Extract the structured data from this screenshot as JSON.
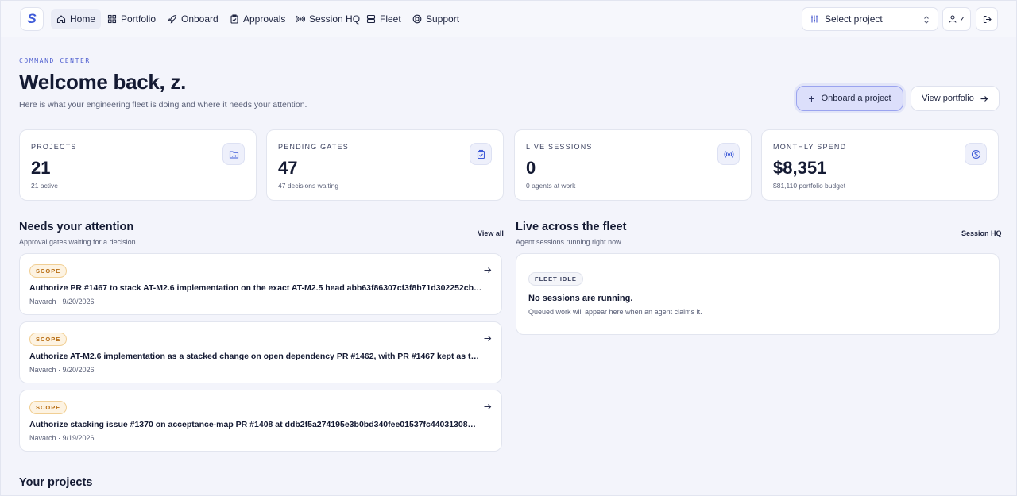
{
  "nav": {
    "logo_letter": "S",
    "items": [
      {
        "label": "Home",
        "icon": "home-icon"
      },
      {
        "label": "Portfolio",
        "icon": "grid-icon"
      },
      {
        "label": "Onboard",
        "icon": "rocket-icon"
      },
      {
        "label": "Approvals",
        "icon": "clipboard-check-icon"
      },
      {
        "label": "Session HQ",
        "icon": "broadcast-icon"
      },
      {
        "label": "Fleet",
        "icon": "server-icon"
      },
      {
        "label": "Support",
        "icon": "lifebuoy-icon"
      }
    ],
    "select_project": "Select project",
    "user_initial": "z"
  },
  "header": {
    "eyebrow": "COMMAND CENTER",
    "title": "Welcome back, z.",
    "subtitle": "Here is what your engineering fleet is doing and where it needs your attention.",
    "primary_button": "Onboard a project",
    "secondary_button": "View portfolio"
  },
  "stats": [
    {
      "label": "PROJECTS",
      "value": "21",
      "sub": "21 active",
      "icon": "folder-chart-icon"
    },
    {
      "label": "PENDING GATES",
      "value": "47",
      "sub": "47 decisions waiting",
      "icon": "clipboard-check-icon"
    },
    {
      "label": "LIVE SESSIONS",
      "value": "0",
      "sub": "0 agents at work",
      "icon": "broadcast-icon"
    },
    {
      "label": "MONTHLY SPEND",
      "value": "$8,351",
      "sub": "$81,110 portfolio budget",
      "icon": "dollar-circle-icon"
    }
  ],
  "attention": {
    "title": "Needs your attention",
    "subtitle": "Approval gates waiting for a decision.",
    "link": "View all",
    "items": [
      {
        "badge": "SCOPE",
        "title": "Authorize PR #1467 to stack AT-M2.6 implementation on the exact AT-M2.5 head abb63f86307cf3f8b71d302252cb…",
        "meta": "Navarch · 9/20/2026"
      },
      {
        "badge": "SCOPE",
        "title": "Authorize AT-M2.6 implementation as a stacked change on open dependency PR #1462, with PR #1467 kept as the …",
        "meta": "Navarch · 9/20/2026"
      },
      {
        "badge": "SCOPE",
        "title": "Authorize stacking issue #1370 on acceptance-map PR #1408 at ddb2f5a274195e3b0bd340fee01537fc44031308…",
        "meta": "Navarch · 9/19/2026"
      }
    ]
  },
  "fleet": {
    "title": "Live across the fleet",
    "subtitle": "Agent sessions running right now.",
    "link": "Session HQ",
    "badge": "FLEET IDLE",
    "empty_title": "No sessions are running.",
    "empty_sub": "Queued work will appear here when an agent claims it."
  },
  "projects": {
    "title": "Your projects"
  }
}
